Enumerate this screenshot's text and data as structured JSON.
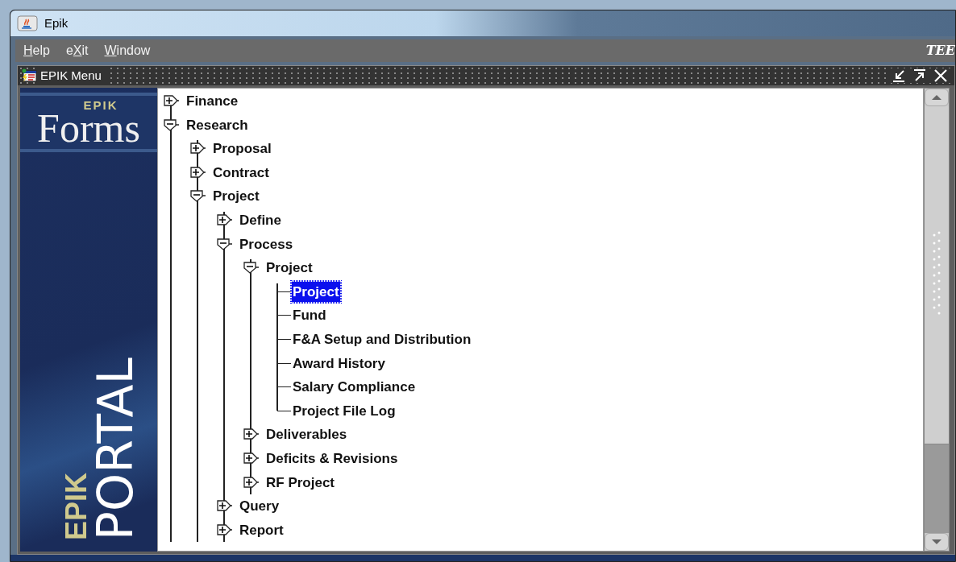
{
  "window": {
    "title": "Epik"
  },
  "menu_bar": {
    "items": [
      {
        "mnemonic": "H",
        "suffix": "elp"
      },
      {
        "prefix": "e",
        "mnemonic": "X",
        "suffix": "it"
      },
      {
        "mnemonic": "W",
        "suffix": "indow"
      }
    ],
    "banner": "TEE"
  },
  "inner_window": {
    "title": "EPIK Menu"
  },
  "side_panel": {
    "logo_small": "EPIK",
    "logo_main": "Forms",
    "vertical_small": "EPIK",
    "vertical_main": "PORTAL"
  },
  "tree": [
    {
      "label": "Finance",
      "kind": "folder",
      "expanded": false,
      "selected": false
    },
    {
      "label": "Research",
      "kind": "folder",
      "expanded": true,
      "selected": false,
      "children": [
        {
          "label": "Proposal",
          "kind": "folder",
          "expanded": false,
          "selected": false
        },
        {
          "label": "Contract",
          "kind": "folder",
          "expanded": false,
          "selected": false
        },
        {
          "label": "Project",
          "kind": "folder",
          "expanded": true,
          "selected": false,
          "children": [
            {
              "label": "Define",
              "kind": "folder",
              "expanded": false,
              "selected": false
            },
            {
              "label": "Process",
              "kind": "folder",
              "expanded": true,
              "selected": false,
              "children": [
                {
                  "label": "Project",
                  "kind": "folder",
                  "expanded": true,
                  "selected": false,
                  "children": [
                    {
                      "label": "Project",
                      "kind": "leaf",
                      "selected": true
                    },
                    {
                      "label": "Fund",
                      "kind": "leaf",
                      "selected": false
                    },
                    {
                      "label": "F&A Setup and Distribution",
                      "kind": "leaf",
                      "selected": false
                    },
                    {
                      "label": "Award History",
                      "kind": "leaf",
                      "selected": false
                    },
                    {
                      "label": "Salary Compliance",
                      "kind": "leaf",
                      "selected": false
                    },
                    {
                      "label": "Project File Log",
                      "kind": "leaf",
                      "selected": false
                    }
                  ]
                },
                {
                  "label": "Deliverables",
                  "kind": "folder",
                  "expanded": false,
                  "selected": false
                },
                {
                  "label": "Deficits & Revisions",
                  "kind": "folder",
                  "expanded": false,
                  "selected": false
                },
                {
                  "label": "RF Project",
                  "kind": "folder",
                  "expanded": false,
                  "selected": false
                }
              ]
            },
            {
              "label": "Query",
              "kind": "folder",
              "expanded": false,
              "selected": false
            },
            {
              "label": "Report",
              "kind": "folder",
              "expanded": false,
              "selected": false
            }
          ]
        }
      ]
    }
  ]
}
